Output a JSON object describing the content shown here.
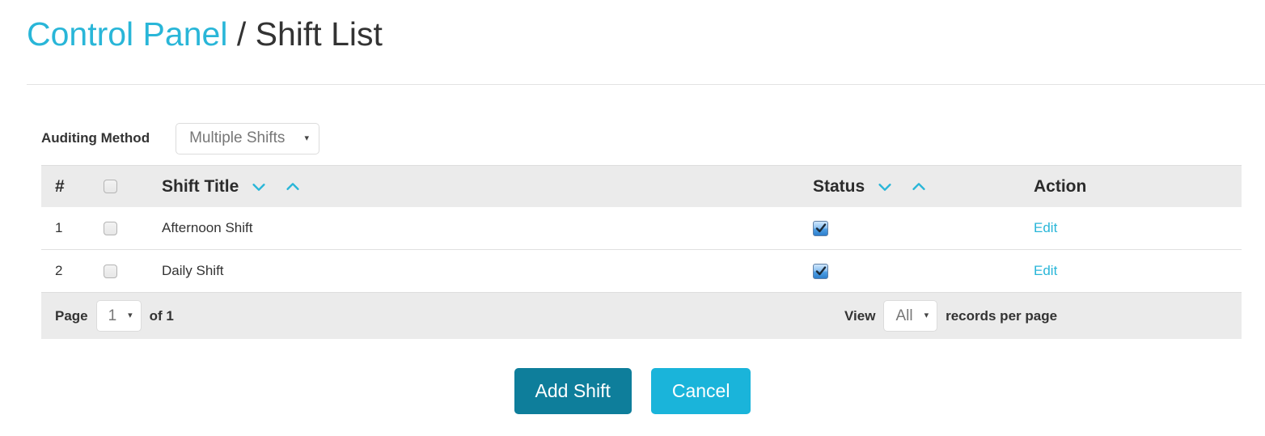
{
  "header": {
    "breadcrumb_link": "Control Panel",
    "breadcrumb_separator": "/",
    "breadcrumb_current": "Shift List"
  },
  "filters": {
    "auditing_method_label": "Auditing Method",
    "auditing_method_value": "Multiple Shifts",
    "caret_glyph": "▾"
  },
  "table": {
    "columns": {
      "number": "#",
      "title": "Shift Title",
      "status": "Status",
      "action": "Action"
    },
    "rows": [
      {
        "number": "1",
        "selected": false,
        "title": "Afternoon Shift",
        "status_checked": true,
        "action_label": "Edit"
      },
      {
        "number": "2",
        "selected": false,
        "title": "Daily Shift",
        "status_checked": true,
        "action_label": "Edit"
      }
    ]
  },
  "footer": {
    "page_label": "Page",
    "page_value": "1",
    "of_label": "of 1",
    "view_label": "View",
    "view_value": "All",
    "records_label": "records per page"
  },
  "actions": {
    "primary_label": "Add Shift",
    "secondary_label": "Cancel"
  },
  "colors": {
    "accent": "#29b6d8",
    "primary_button": "#0e7e9b",
    "secondary_button": "#1ab4da",
    "header_row": "#ebebeb"
  }
}
